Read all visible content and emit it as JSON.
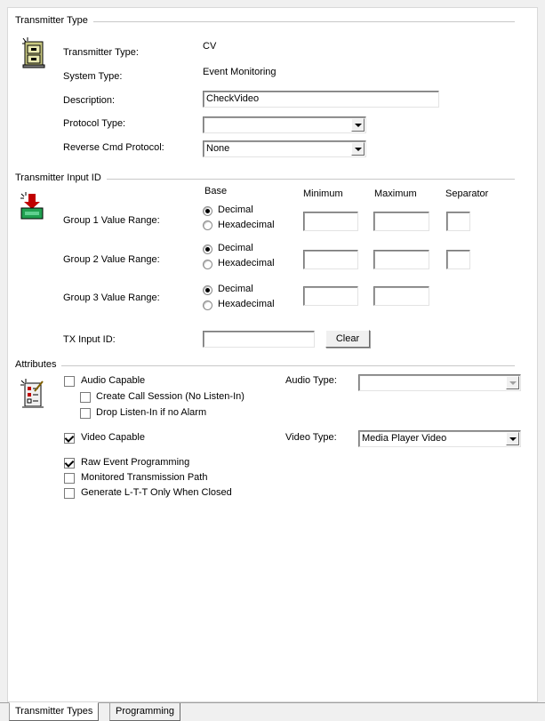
{
  "sections": {
    "transmitter_type": "Transmitter Type",
    "input_id": "Transmitter Input ID",
    "attributes": "Attributes"
  },
  "transmitter": {
    "type_label": "Transmitter Type:",
    "type_value": "CV",
    "system_type_label": "System Type:",
    "system_type_value": "Event Monitoring",
    "description_label": "Description:",
    "description_value": "CheckVideo",
    "protocol_type_label": "Protocol Type:",
    "protocol_type_value": "",
    "reverse_cmd_label": "Reverse Cmd Protocol:",
    "reverse_cmd_value": "None"
  },
  "input_id": {
    "col_base": "Base",
    "col_minimum": "Minimum",
    "col_maximum": "Maximum",
    "col_separator": "Separator",
    "groups": [
      {
        "label": "Group 1 Value Range:",
        "decimal": "Decimal",
        "hex": "Hexadecimal",
        "selected": "decimal"
      },
      {
        "label": "Group 2 Value Range:",
        "decimal": "Decimal",
        "hex": "Hexadecimal",
        "selected": "decimal"
      },
      {
        "label": "Group 3 Value Range:",
        "decimal": "Decimal",
        "hex": "Hexadecimal",
        "selected": "decimal"
      }
    ],
    "tx_input_label": "TX Input ID:",
    "tx_input_value": "",
    "clear_label": "Clear"
  },
  "attributes": {
    "audio_capable": {
      "label": "Audio Capable",
      "checked": false
    },
    "create_call_session": {
      "label": "Create Call Session (No Listen-In)",
      "checked": false
    },
    "drop_listen_in": {
      "label": "Drop Listen-In if no Alarm",
      "checked": false
    },
    "video_capable": {
      "label": "Video Capable",
      "checked": true
    },
    "raw_event_programming": {
      "label": "Raw Event Programming",
      "checked": true
    },
    "monitored_path": {
      "label": "Monitored Transmission Path",
      "checked": false
    },
    "generate_ltt": {
      "label": "Generate L-T-T Only When Closed",
      "checked": false
    },
    "audio_type_label": "Audio Type:",
    "audio_type_value": "",
    "video_type_label": "Video Type:",
    "video_type_value": "Media Player Video"
  },
  "tabs": [
    {
      "label": "Transmitter Types",
      "active": true
    },
    {
      "label": "Programming",
      "active": false
    }
  ],
  "icons": {
    "transmitter": "cabinet-icon",
    "input": "download-tray-icon",
    "attributes": "checklist-icon"
  }
}
